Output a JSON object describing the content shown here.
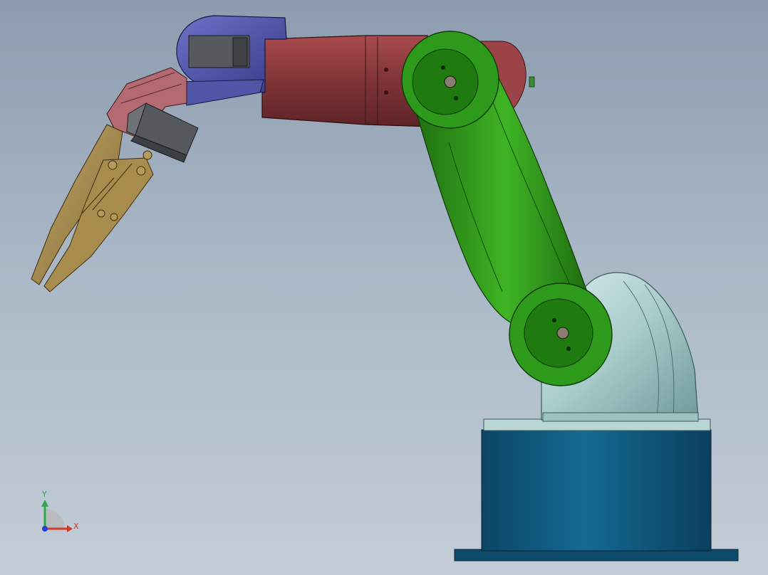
{
  "triad": {
    "x_label": "X",
    "y_label": "Y",
    "x_color": "#d23a2a",
    "y_color": "#2ea84a",
    "z_color": "#2a3cd6"
  },
  "colors": {
    "background_top": "#8c9cae",
    "background_bottom": "#c3cdd7",
    "base_pedestal": "#0f5478",
    "base_joint": "#a8cbcb",
    "lower_arm": "#2f9e1a",
    "upper_arm": "#8a3a3c",
    "wrist": "#4a4fa0",
    "gripper_mount": "#b0686e",
    "servo": "#505458",
    "gripper_fingers": "#9c8248"
  }
}
